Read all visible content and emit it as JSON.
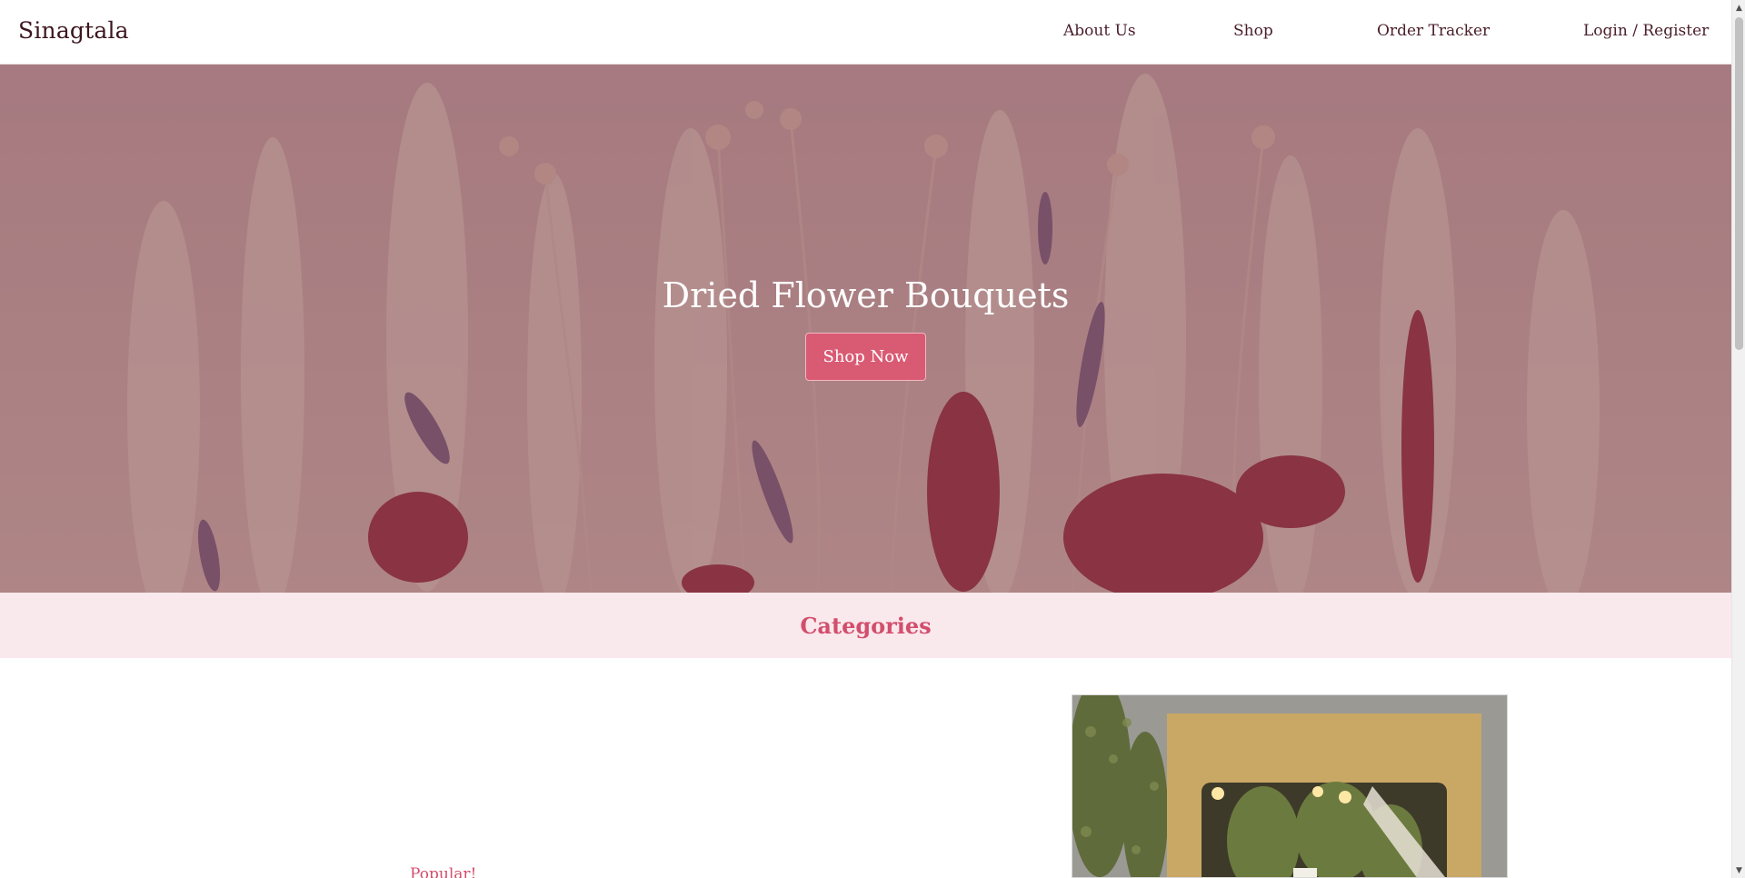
{
  "nav": {
    "brand": "Sinagtala",
    "links": [
      "About Us",
      "Shop",
      "Order Tracker",
      "Login / Register"
    ]
  },
  "hero": {
    "title": "Dried Flower Bouquets",
    "cta_label": "Shop Now"
  },
  "categories": {
    "heading": "Categories",
    "featured_label": "Popular!"
  },
  "scrollbar": {
    "up_icon": "▲",
    "down_icon": "▼"
  },
  "colors": {
    "accent": "#d34e6c",
    "button": "#d95a73",
    "band": "#f9e8ec",
    "text_dark": "#4a1e2a",
    "hero_tint": "#7d5a63"
  }
}
